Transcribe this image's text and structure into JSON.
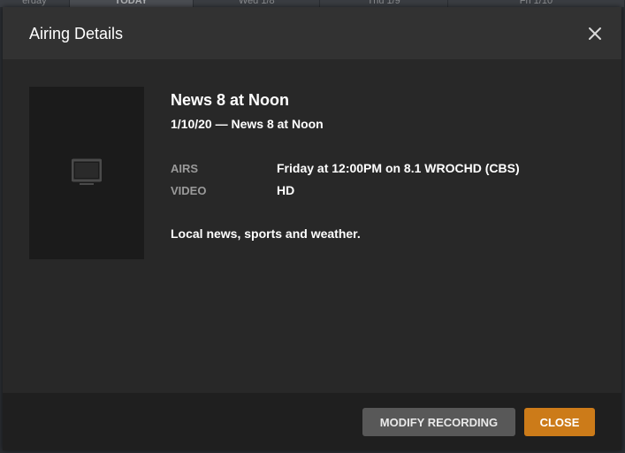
{
  "background_tabs": [
    {
      "label": "erday"
    },
    {
      "label": "TODAY",
      "active": true
    },
    {
      "label": "Wed 1/8"
    },
    {
      "label": "Thu 1/9"
    },
    {
      "label": "Fri 1/10"
    }
  ],
  "modal": {
    "title": "Airing Details",
    "program": {
      "title": "News 8 at Noon",
      "subtitle": "1/10/20 — News 8 at Noon",
      "airs_label": "AIRS",
      "airs_value": "Friday at 12:00PM on 8.1 WROCHD (CBS)",
      "video_label": "VIDEO",
      "video_value": "HD",
      "description": "Local news, sports and weather."
    },
    "footer": {
      "modify_label": "MODIFY RECORDING",
      "close_label": "CLOSE"
    }
  },
  "colors": {
    "accent": "#cc7b19",
    "secondary_button": "#585858",
    "header_bg": "#323232",
    "body_bg": "#282828",
    "footer_bg": "#1f1f1f"
  },
  "icons": {
    "close": "close-icon",
    "poster_placeholder": "tv-icon"
  }
}
